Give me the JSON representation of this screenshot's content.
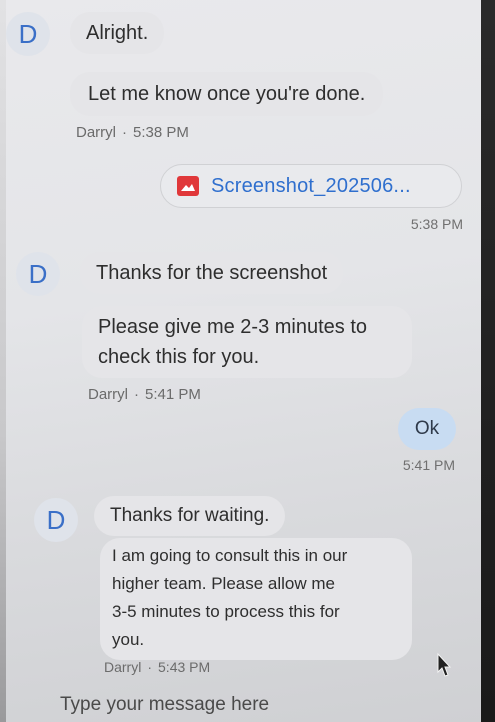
{
  "messages": [
    {
      "avatar": "D",
      "text": "Alright."
    },
    {
      "text": "Let me know once you're done."
    },
    {
      "sender": "Darryl",
      "time": "5:38 PM"
    }
  ],
  "attachment": {
    "icon": "image-icon",
    "filename": "Screenshot_202506...",
    "time": "5:38 PM"
  },
  "group2": {
    "avatar": "D",
    "line1": "Thanks for the screenshot",
    "line2a": "Please give me 2-3 minutes to",
    "line2b": "check this for you.",
    "sender": "Darryl",
    "time": "5:41 PM"
  },
  "outgoing": {
    "text": "Ok",
    "time": "5:41 PM"
  },
  "group3": {
    "avatar": "D",
    "line1": "Thanks for waiting.",
    "line2a": "I am going to consult this in our",
    "line2b": "higher team. Please allow me",
    "line2c": "3-5 minutes to process this for",
    "line2d": "you.",
    "sender": "Darryl",
    "time": "5:43 PM"
  },
  "composer": {
    "placeholder": "Type your message here"
  },
  "meta_separator": "·",
  "colors": {
    "accent_blue": "#2f6fce",
    "outgoing_bubble": "#c8dcf2",
    "incoming_bubble": "#e5e5e8",
    "attachment_icon": "#e0383a"
  }
}
